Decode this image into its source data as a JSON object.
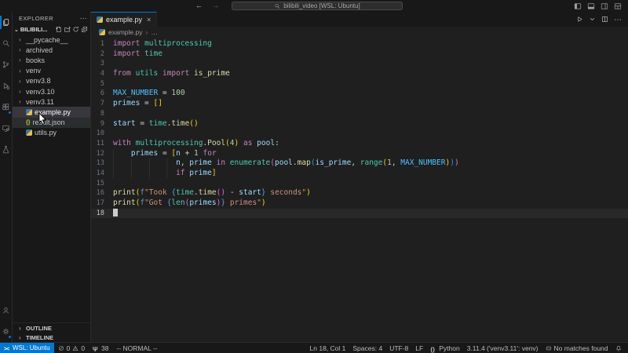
{
  "colors": {
    "accent": "#0078d4",
    "remote_bg": "#0078d4",
    "editor_bg": "#1f1f1f",
    "sidebar_bg": "#181818"
  },
  "title_bar": {
    "back_icon": "←",
    "forward_icon": "→",
    "search": {
      "icon": "search",
      "text": "bilibili_video [WSL: Ubuntu]"
    },
    "window_icons": [
      "layout-sidebar-left",
      "layout-panel",
      "layout-sidebar-right",
      "layout-customize"
    ]
  },
  "activity_bar": {
    "top": [
      {
        "name": "explorer",
        "icon": "files",
        "active": true,
        "badge": false
      },
      {
        "name": "search",
        "icon": "search",
        "active": false,
        "badge": false
      },
      {
        "name": "source-control",
        "icon": "source-control",
        "active": false,
        "badge": false
      },
      {
        "name": "run-and-debug",
        "icon": "debug",
        "active": false,
        "badge": false
      },
      {
        "name": "extensions",
        "icon": "extensions",
        "active": false,
        "badge": true
      },
      {
        "name": "remote-explorer",
        "icon": "remote-explorer",
        "active": false,
        "badge": false
      },
      {
        "name": "testing",
        "icon": "testing",
        "active": false,
        "badge": false
      }
    ],
    "bottom": [
      {
        "name": "accounts",
        "icon": "account",
        "active": false,
        "badge": false
      },
      {
        "name": "settings",
        "icon": "settings",
        "active": false,
        "badge": true
      }
    ]
  },
  "sidebar": {
    "title": "EXPLORER",
    "more_icon": "⋯",
    "section": {
      "chevron": "⌄",
      "label": "BILIBILI...",
      "actions": [
        "new-file",
        "new-folder",
        "refresh",
        "collapse-all"
      ]
    },
    "folders": [
      "__pycache__",
      "archived",
      "books",
      "venv",
      "venv3.8",
      "venv3.10",
      "venv3.11"
    ],
    "folder_chevron": "›",
    "files": [
      {
        "name": "example.py",
        "icon": "python",
        "state": "selected"
      },
      {
        "name": "result.json",
        "icon": "json",
        "state": "hover"
      },
      {
        "name": "utils.py",
        "icon": "python",
        "state": ""
      }
    ],
    "bottom_sections": [
      "OUTLINE",
      "TIMELINE"
    ]
  },
  "editor": {
    "tab": {
      "label": "example.py",
      "close_icon": "×"
    },
    "actions": [
      {
        "name": "run",
        "icon": "play"
      },
      {
        "name": "run-dropdown",
        "icon": "chevron-down"
      },
      {
        "name": "split-editor",
        "icon": "split"
      },
      {
        "name": "more-actions",
        "icon": "ellipsis"
      }
    ],
    "breadcrumb": {
      "file": "example.py",
      "separator": "›",
      "symbol": "…"
    },
    "code": {
      "active_line": 18,
      "lines": [
        {
          "tokens": [
            [
              "kw",
              "import"
            ],
            [
              "pl",
              " "
            ],
            [
              "mod",
              "multiprocessing"
            ]
          ],
          "guides": 0
        },
        {
          "tokens": [
            [
              "kw",
              "import"
            ],
            [
              "pl",
              " "
            ],
            [
              "mod",
              "time"
            ]
          ],
          "guides": 0
        },
        {
          "tokens": [],
          "guides": 0
        },
        {
          "tokens": [
            [
              "kw",
              "from"
            ],
            [
              "pl",
              " "
            ],
            [
              "mod",
              "utils"
            ],
            [
              "pl",
              " "
            ],
            [
              "kw",
              "import"
            ],
            [
              "pl",
              " "
            ],
            [
              "fn",
              "is_prime"
            ]
          ],
          "guides": 0
        },
        {
          "tokens": [],
          "guides": 0
        },
        {
          "tokens": [
            [
              "const",
              "MAX_NUMBER"
            ],
            [
              "pl",
              " = "
            ],
            [
              "num",
              "100"
            ]
          ],
          "guides": 0
        },
        {
          "tokens": [
            [
              "var",
              "primes"
            ],
            [
              "pl",
              " = "
            ],
            [
              "b1",
              "[]"
            ]
          ],
          "guides": 0
        },
        {
          "tokens": [],
          "guides": 0
        },
        {
          "tokens": [
            [
              "var",
              "start"
            ],
            [
              "pl",
              " = "
            ],
            [
              "mod",
              "time"
            ],
            [
              "pl",
              "."
            ],
            [
              "fn",
              "time"
            ],
            [
              "b1",
              "()"
            ]
          ],
          "guides": 0
        },
        {
          "tokens": [],
          "guides": 0
        },
        {
          "tokens": [
            [
              "kw",
              "with"
            ],
            [
              "pl",
              " "
            ],
            [
              "mod",
              "multiprocessing"
            ],
            [
              "pl",
              "."
            ],
            [
              "fn",
              "Pool"
            ],
            [
              "b1",
              "("
            ],
            [
              "num",
              "4"
            ],
            [
              "b1",
              ")"
            ],
            [
              "pl",
              " "
            ],
            [
              "kw",
              "as"
            ],
            [
              "pl",
              " "
            ],
            [
              "var",
              "pool"
            ],
            [
              "pl",
              ":"
            ]
          ],
          "guides": 0
        },
        {
          "tokens": [
            [
              "pl",
              "    "
            ],
            [
              "var",
              "primes"
            ],
            [
              "pl",
              " = "
            ],
            [
              "b1",
              "["
            ],
            [
              "var",
              "n"
            ],
            [
              "pl",
              " + "
            ],
            [
              "num",
              "1"
            ],
            [
              "pl",
              " "
            ],
            [
              "kw",
              "for"
            ]
          ],
          "guides": 1
        },
        {
          "tokens": [
            [
              "pl",
              "              "
            ],
            [
              "var",
              "n"
            ],
            [
              "pl",
              ", "
            ],
            [
              "var",
              "prime"
            ],
            [
              "pl",
              " "
            ],
            [
              "kw",
              "in"
            ],
            [
              "pl",
              " "
            ],
            [
              "mod",
              "enumerate"
            ],
            [
              "b2",
              "("
            ],
            [
              "var",
              "pool"
            ],
            [
              "pl",
              "."
            ],
            [
              "fn",
              "map"
            ],
            [
              "b3",
              "("
            ],
            [
              "var",
              "is_prime"
            ],
            [
              "pl",
              ", "
            ],
            [
              "mod",
              "range"
            ],
            [
              "b1",
              "("
            ],
            [
              "num",
              "1"
            ],
            [
              "pl",
              ", "
            ],
            [
              "const",
              "MAX_NUMBER"
            ],
            [
              "b1",
              ")"
            ],
            [
              "b3",
              ")"
            ],
            [
              "b2",
              ")"
            ]
          ],
          "guides": 4
        },
        {
          "tokens": [
            [
              "pl",
              "              "
            ],
            [
              "kw",
              "if"
            ],
            [
              "pl",
              " "
            ],
            [
              "var",
              "prime"
            ],
            [
              "b1",
              "]"
            ]
          ],
          "guides": 4
        },
        {
          "tokens": [],
          "guides": 0
        },
        {
          "tokens": [
            [
              "fn",
              "print"
            ],
            [
              "b1",
              "("
            ],
            [
              "fs",
              "f"
            ],
            [
              "str",
              "\"Took "
            ],
            [
              "fs",
              "{"
            ],
            [
              "mod",
              "time"
            ],
            [
              "pl",
              "."
            ],
            [
              "fn",
              "time"
            ],
            [
              "b2",
              "()"
            ],
            [
              "pl",
              " - "
            ],
            [
              "var",
              "start"
            ],
            [
              "fs",
              "}"
            ],
            [
              "str",
              " seconds\""
            ],
            [
              "b1",
              ")"
            ]
          ],
          "guides": 0
        },
        {
          "tokens": [
            [
              "fn",
              "print"
            ],
            [
              "b1",
              "("
            ],
            [
              "fs",
              "f"
            ],
            [
              "str",
              "\"Got "
            ],
            [
              "fs",
              "{"
            ],
            [
              "mod",
              "len"
            ],
            [
              "b2",
              "("
            ],
            [
              "var",
              "primes"
            ],
            [
              "b2",
              ")"
            ],
            [
              "fs",
              "}"
            ],
            [
              "str",
              " primes\""
            ],
            [
              "b1",
              ")"
            ]
          ],
          "guides": 0
        },
        {
          "tokens": [],
          "guides": 0
        }
      ]
    }
  },
  "status_bar": {
    "left": [
      {
        "type": "remote",
        "icon": "remote",
        "label": "WSL: Ubuntu"
      },
      {
        "type": "problems",
        "error_icon": "error",
        "errors": "0",
        "warning_icon": "warning",
        "warnings": "0"
      },
      {
        "type": "indicator",
        "icon": "antenna",
        "label": "38"
      },
      {
        "type": "mode",
        "label": "-- NORMAL --"
      }
    ],
    "right": [
      {
        "name": "cursor-position",
        "icon": "",
        "label": "Ln 18, Col 1"
      },
      {
        "name": "indentation",
        "icon": "",
        "label": "Spaces: 4"
      },
      {
        "name": "encoding",
        "icon": "",
        "label": "UTF-8"
      },
      {
        "name": "eol",
        "icon": "",
        "label": "LF"
      },
      {
        "name": "language-mode",
        "icon": "braces",
        "label": "Python"
      },
      {
        "name": "python-interpreter",
        "icon": "",
        "label": "3.11.4 ('venv3.11': venv)"
      },
      {
        "name": "matches-status",
        "icon": "copilot",
        "label": "No matches found"
      },
      {
        "name": "notifications",
        "icon": "bell",
        "label": ""
      }
    ]
  }
}
